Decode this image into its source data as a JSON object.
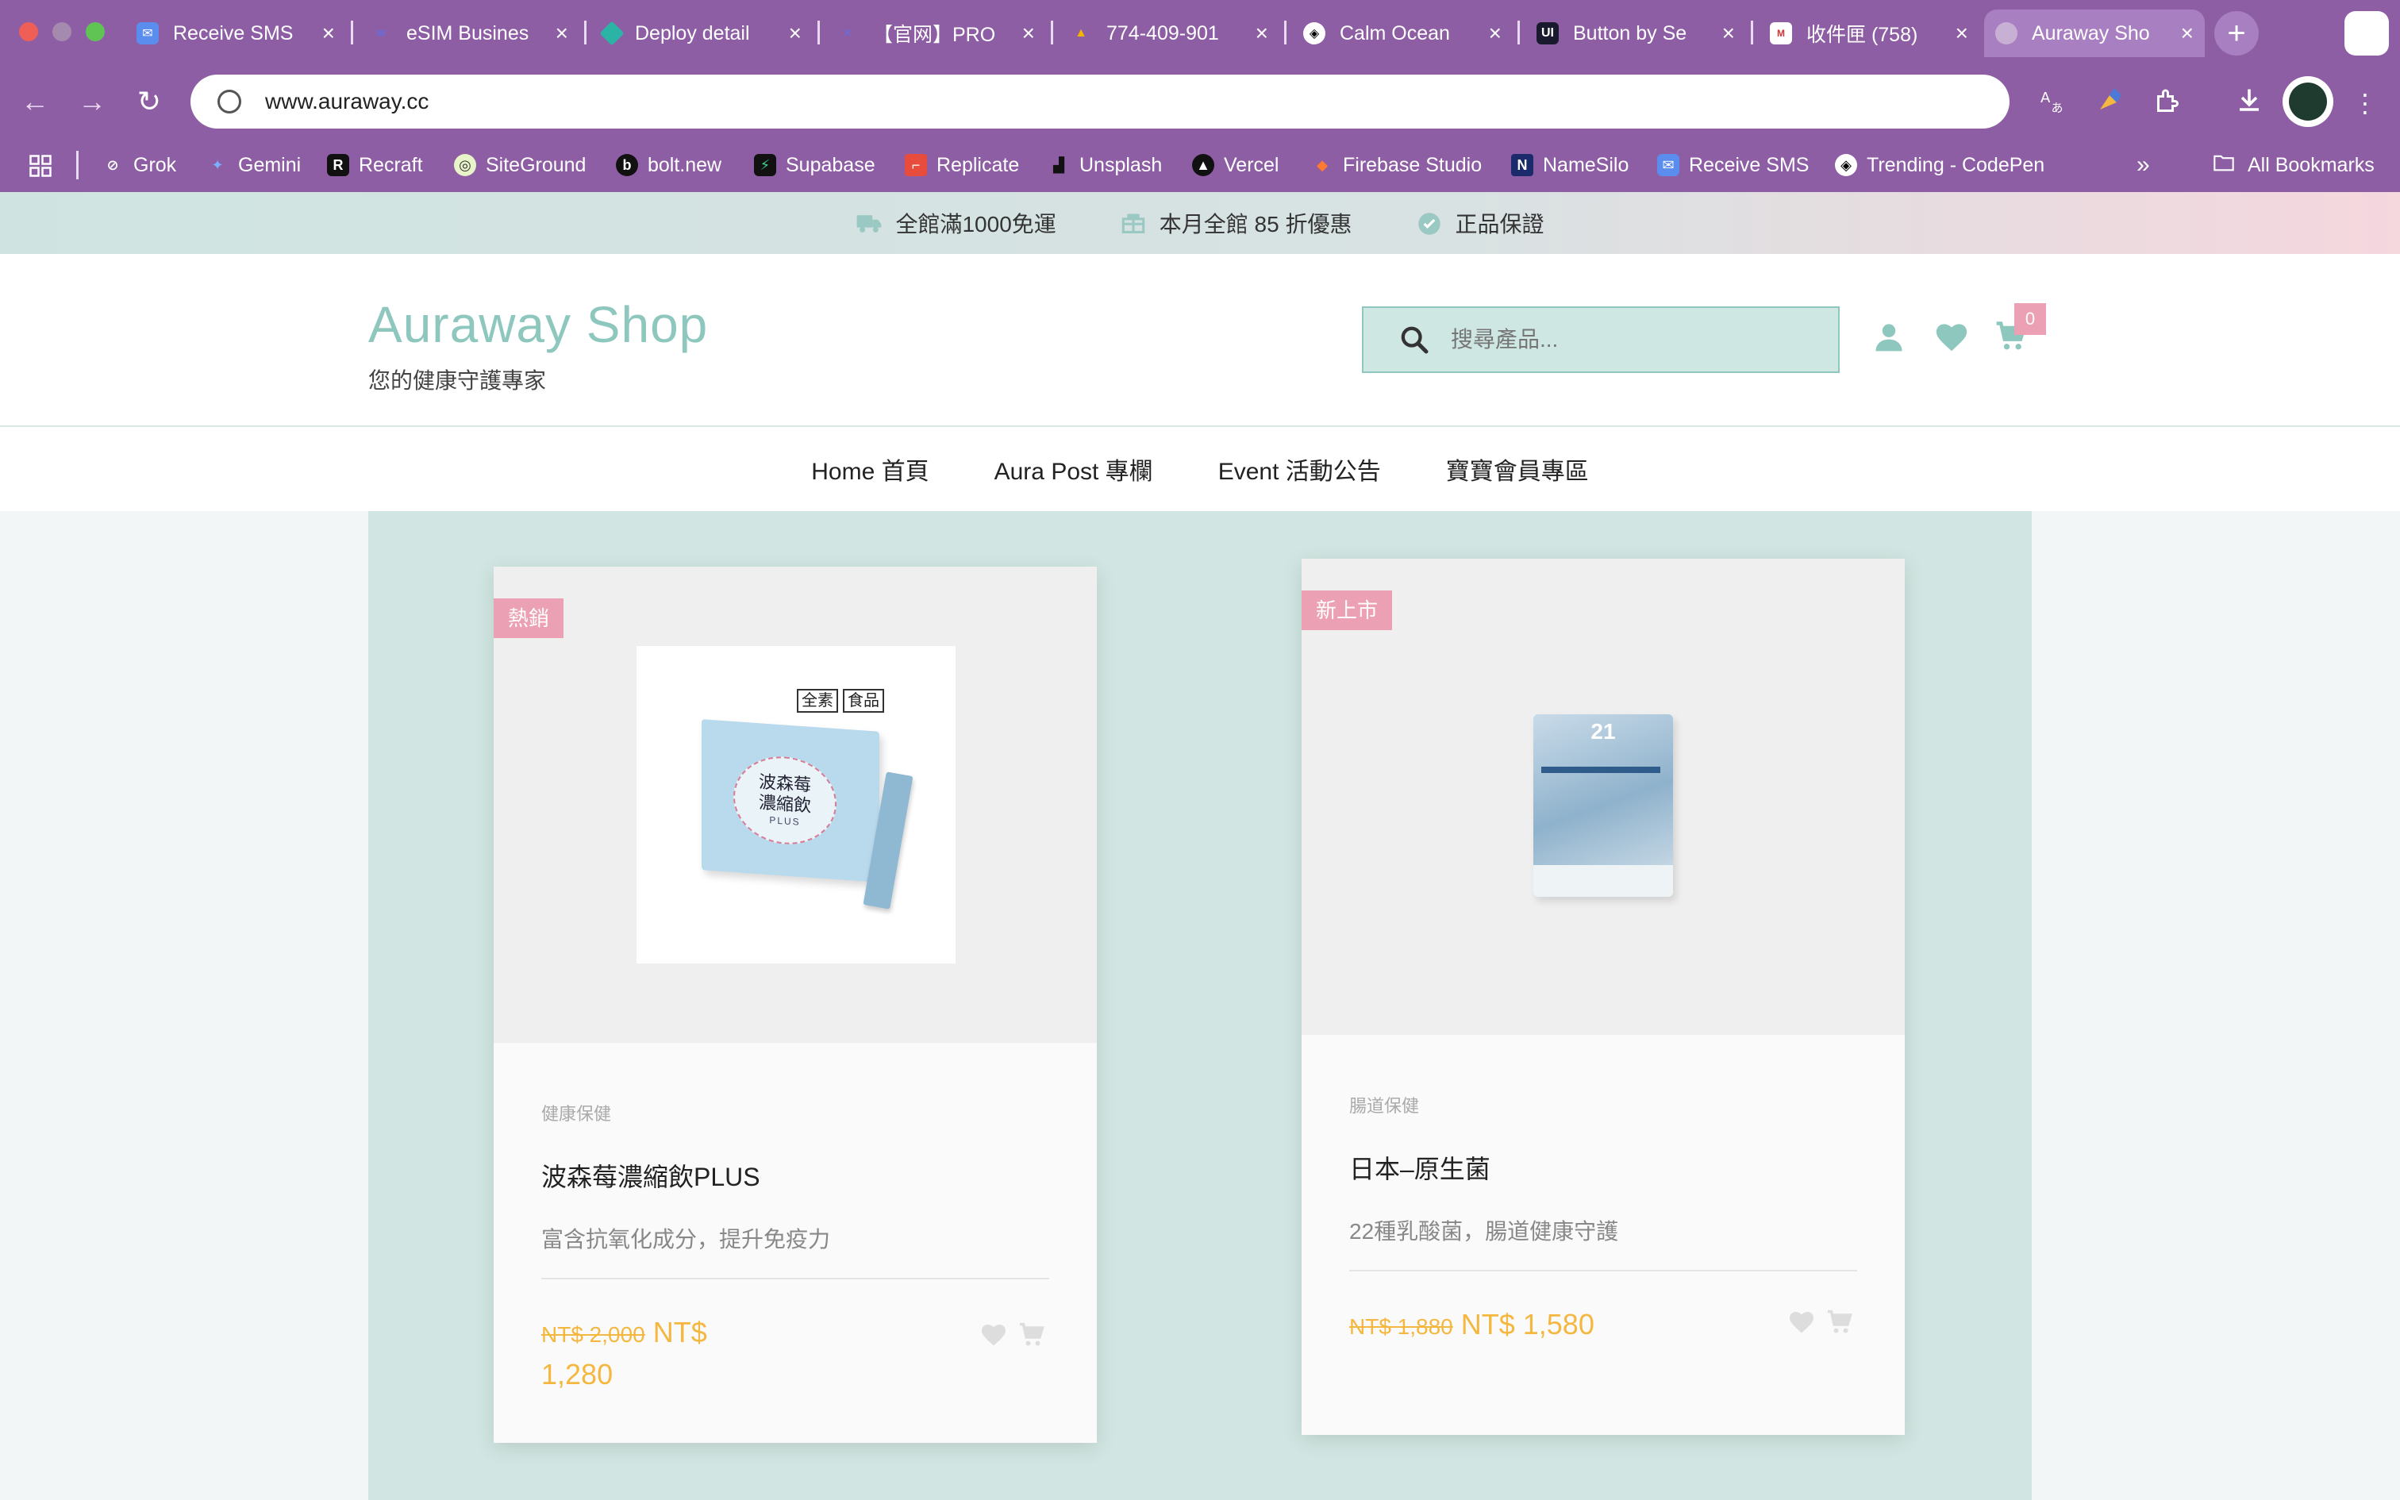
{
  "browser": {
    "tabs": [
      {
        "label": "Receive SMS",
        "favicon": "sms-icon",
        "active": false
      },
      {
        "label": "eSIM Busines",
        "favicon": "esim-icon",
        "active": false
      },
      {
        "label": "Deploy detail",
        "favicon": "netlify-icon",
        "active": false
      },
      {
        "label": "【官网】PRO",
        "favicon": "proxy-icon",
        "active": false
      },
      {
        "label": "774-409-901",
        "favicon": "drive-icon",
        "active": false
      },
      {
        "label": "Calm Ocean",
        "favicon": "codepen-icon",
        "active": false
      },
      {
        "label": "Button by Se",
        "favicon": "uiverse-icon",
        "active": false
      },
      {
        "label": "收件匣 (758)",
        "favicon": "mail-icon",
        "active": false
      },
      {
        "label": "Auraway Sho",
        "favicon": "globe-icon",
        "active": true
      }
    ],
    "url": "www.auraway.cc",
    "bookmarks": [
      {
        "label": "Grok",
        "icon": "grok-icon"
      },
      {
        "label": "Gemini",
        "icon": "gemini-icon"
      },
      {
        "label": "Recraft",
        "icon": "recraft-icon"
      },
      {
        "label": "SiteGround",
        "icon": "siteground-icon"
      },
      {
        "label": "bolt.new",
        "icon": "bolt-icon"
      },
      {
        "label": "Supabase",
        "icon": "supabase-icon"
      },
      {
        "label": "Replicate",
        "icon": "replicate-icon"
      },
      {
        "label": "Unsplash",
        "icon": "unsplash-icon"
      },
      {
        "label": "Vercel",
        "icon": "vercel-icon"
      },
      {
        "label": "Firebase Studio",
        "icon": "firebase-icon"
      },
      {
        "label": "NameSilo",
        "icon": "namesilo-icon"
      },
      {
        "label": "Receive SMS",
        "icon": "sms-icon"
      },
      {
        "label": "Trending - CodePen",
        "icon": "codepen-icon"
      }
    ],
    "bookmarks_overflow": "»",
    "all_bookmarks": "All Bookmarks",
    "colors": {
      "chrome": "#8d5ea3",
      "active_tab": "#a87fc0"
    }
  },
  "announcement": {
    "items": [
      {
        "text": "全館滿1000免運",
        "icon": "truck-icon"
      },
      {
        "text": "本月全館 85 折優惠",
        "icon": "gift-icon"
      },
      {
        "text": "正品保證",
        "icon": "verified-icon"
      }
    ]
  },
  "header": {
    "logo": "Auraway Shop",
    "tagline": "您的健康守護專家",
    "search_placeholder": "搜尋產品...",
    "cart_count": "0",
    "colors": {
      "brand": "#8ec7bd",
      "badge": "#eba1b3",
      "price": "#f4b740"
    }
  },
  "nav": {
    "items": [
      "Home 首頁",
      "Aura Post 專欄",
      "Event 活動公告",
      "寶寶會員專區"
    ]
  },
  "products": [
    {
      "badge": "熱銷",
      "category": "健康保健",
      "name": "波森莓濃縮飲PLUS",
      "description": "富含抗氧化成分，提升免疫力",
      "old_price": "NT$ 2,000",
      "price_line1": "NT$",
      "price_line2": "1,280",
      "image_labels": [
        "全素",
        "食品"
      ],
      "box_text": "波森莓濃縮飲",
      "box_sub": "PLUS"
    },
    {
      "badge": "新上市",
      "category": "腸道保健",
      "name": "日本–原生菌",
      "description": "22種乳酸菌，腸道健康守護",
      "old_price": "NT$ 1,880",
      "price": "NT$ 1,580",
      "box_number": "21"
    }
  ]
}
